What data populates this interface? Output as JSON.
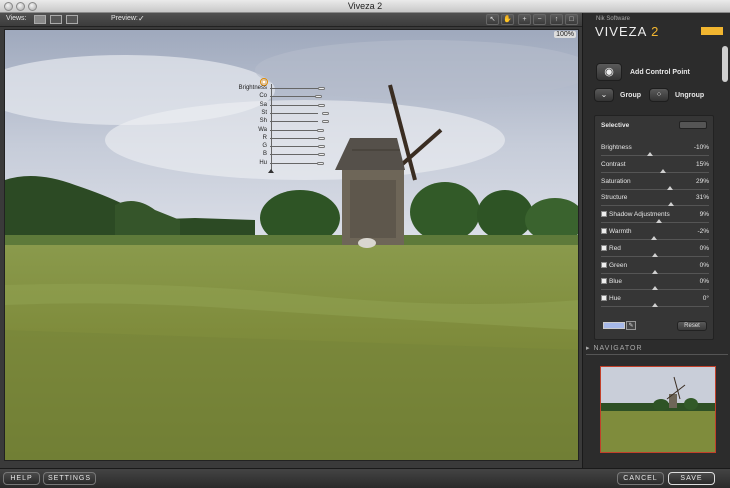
{
  "window": {
    "title": "Viveza 2"
  },
  "toolbar": {
    "views_label": "Views:",
    "preview_label": "Preview:",
    "preview_check": "✓"
  },
  "photo": {
    "zoom_label": "100%"
  },
  "control_point_labels": [
    "Brightness",
    "Co",
    "Sa",
    "St",
    "Sh",
    "Wa",
    "R",
    "G",
    "B",
    "Hu"
  ],
  "panel": {
    "brand_small": "Nik Software",
    "brand_name": "VIVEZA",
    "brand_num": "2",
    "add_control_point": "Add Control Point",
    "group": "Group",
    "ungroup": "Ungroup",
    "selective_title": "Selective",
    "reset_label": "Reset",
    "navigator_title": "NAVIGATOR",
    "navigator_arrow": "▸"
  },
  "sliders": [
    {
      "name": "Brightness",
      "value": "-10%",
      "level": 0.45,
      "checkbox": false
    },
    {
      "name": "Contrast",
      "value": "15%",
      "level": 0.57,
      "checkbox": false
    },
    {
      "name": "Saturation",
      "value": "29%",
      "level": 0.64,
      "checkbox": false
    },
    {
      "name": "Structure",
      "value": "31%",
      "level": 0.65,
      "checkbox": false
    },
    {
      "name": "Shadow Adjustments",
      "value": "9%",
      "level": 0.54,
      "checkbox": true
    },
    {
      "name": "Warmth",
      "value": "-2%",
      "level": 0.49,
      "checkbox": true
    },
    {
      "name": "Red",
      "value": "0%",
      "level": 0.5,
      "checkbox": true
    },
    {
      "name": "Green",
      "value": "0%",
      "level": 0.5,
      "checkbox": true
    },
    {
      "name": "Blue",
      "value": "0%",
      "level": 0.5,
      "checkbox": true
    },
    {
      "name": "Hue",
      "value": "0°",
      "level": 0.5,
      "checkbox": true
    }
  ],
  "bottom": {
    "help": "HELP",
    "settings": "SETTINGS",
    "cancel": "CANCEL",
    "save": "SAVE"
  },
  "colors": {
    "accent": "#f2b630",
    "swatch": "#a6b8e8",
    "navigator_frame": "#c2402a"
  },
  "icons": [
    "view-single-icon",
    "view-split-icon",
    "view-side-by-side-icon",
    "pointer-icon",
    "hand-icon",
    "zoom-in-icon",
    "zoom-out-icon",
    "info-icon",
    "fullscreen-icon",
    "control-point-icon",
    "group-icon",
    "ungroup-icon",
    "eyedropper-icon"
  ]
}
